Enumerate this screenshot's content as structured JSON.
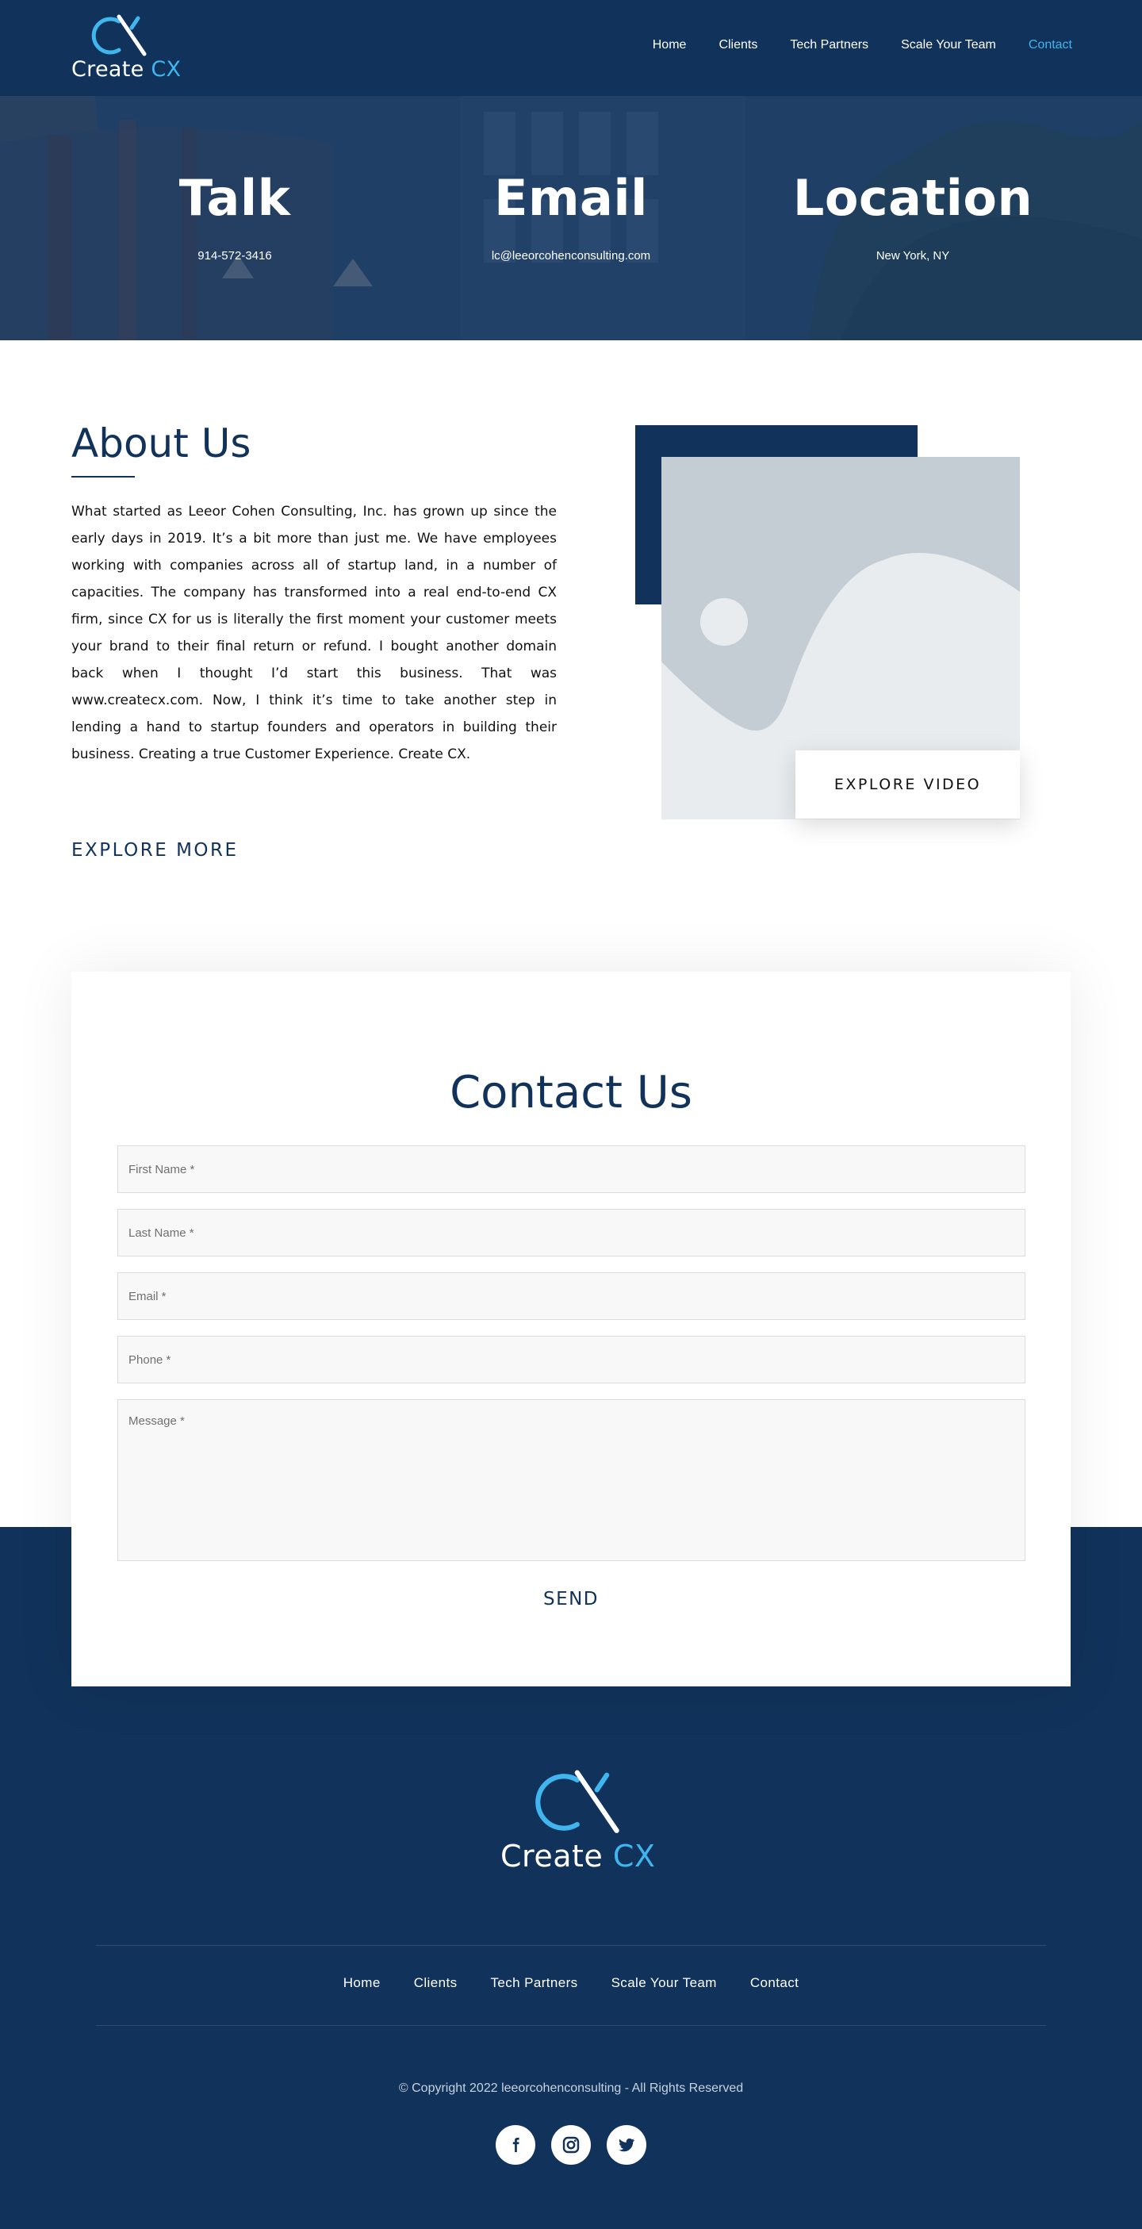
{
  "brand": {
    "logo_text": "Create",
    "logo_accent": "CX",
    "primary_color": "#11325a",
    "accent_color": "#3fb6ee"
  },
  "nav": {
    "items": [
      {
        "label": "Home"
      },
      {
        "label": "Clients"
      },
      {
        "label": "Tech Partners"
      },
      {
        "label": "Scale Your Team"
      },
      {
        "label": "Contact",
        "active": true
      }
    ]
  },
  "hero": {
    "talk": {
      "heading": "Talk",
      "value": "914-572-3416"
    },
    "email": {
      "heading": "Email",
      "value": "lc@leeorcohenconsulting.com"
    },
    "location": {
      "heading": "Location",
      "value": "New York, NY"
    }
  },
  "about": {
    "title": "About Us",
    "body": "What started as Leeor Cohen Consulting, Inc. has grown up since the early days in 2019. It’s a bit more than just me. We have employees working with companies across all of startup land, in a number of capacities. The company has transformed into a real end-to-end CX firm, since CX for us is literally the first moment your customer meets your brand to their final return or refund. I bought another domain back when I thought I’d start this business. That was www.createcx.com. Now, I think it’s time to take another step in lending a hand to startup founders and operators in building their business. Creating a true Customer Experience. Create CX.",
    "explore_more": "EXPLORE MORE",
    "explore_video": "EXPLORE VIDEO"
  },
  "contact": {
    "title": "Contact Us",
    "first_name_placeholder": "First Name *",
    "last_name_placeholder": "Last Name *",
    "email_placeholder": "Email *",
    "phone_placeholder": "Phone *",
    "message_placeholder": "Message *",
    "send_label": "SEND"
  },
  "footer": {
    "logo_text": "Create",
    "logo_accent": "CX",
    "nav": [
      {
        "label": "Home"
      },
      {
        "label": "Clients"
      },
      {
        "label": "Tech Partners"
      },
      {
        "label": "Scale Your Team"
      },
      {
        "label": "Contact"
      }
    ],
    "copyright": "© Copyright 2022 leeorcohenconsulting - All Rights Reserved",
    "socials": [
      {
        "icon": "facebook-icon"
      },
      {
        "icon": "instagram-icon"
      },
      {
        "icon": "twitter-icon"
      }
    ]
  }
}
